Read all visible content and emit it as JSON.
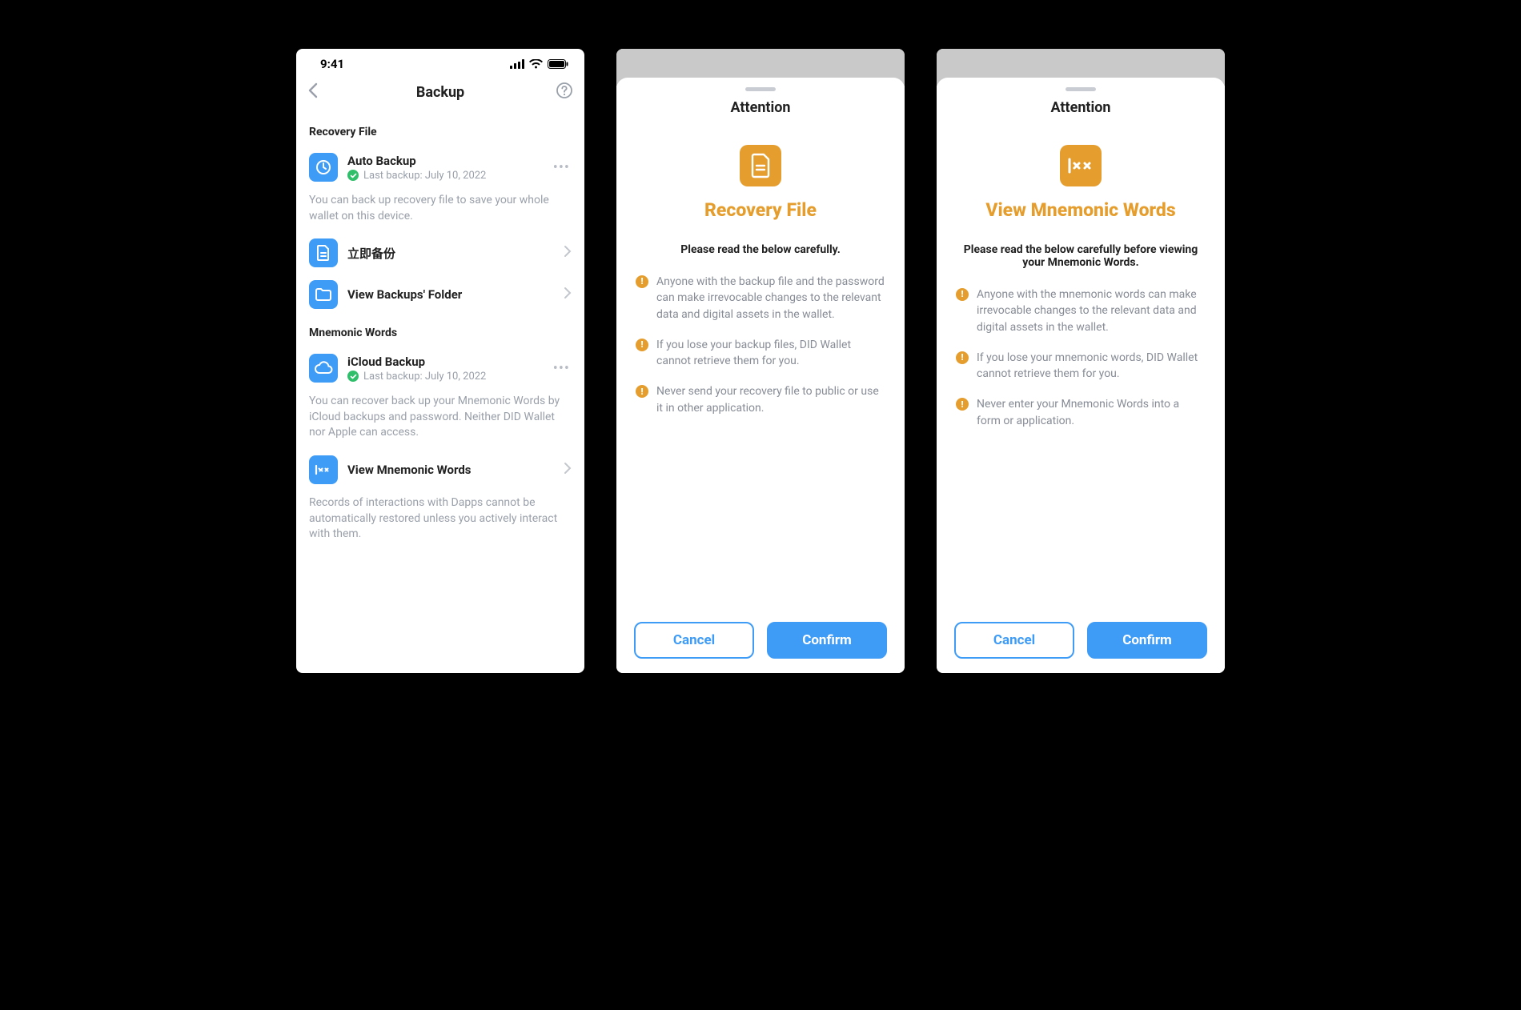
{
  "status": {
    "time": "9:41"
  },
  "screen_backup": {
    "title": "Backup",
    "section_recovery": "Recovery File",
    "auto_backup": {
      "title": "Auto Backup",
      "subtitle": "Last backup: July 10, 2022"
    },
    "recovery_desc": "You can back up recovery file to save your whole wallet on this device.",
    "backup_now": "立即备份",
    "view_backups": "View Backups' Folder",
    "section_mnemonic": "Mnemonic Words",
    "icloud_backup": {
      "title": "iCloud Backup",
      "subtitle": "Last backup: July 10, 2022"
    },
    "mnemonic_desc": "You can recover back up your Mnemonic Words by iCloud backups and password. Neither DID Wallet nor Apple can access.",
    "view_mnemonic": "View Mnemonic Words",
    "footnote": "Records of interactions with Dapps cannot be automatically restored unless you actively interact with them."
  },
  "modal_recovery": {
    "attention": "Attention",
    "heading": "Recovery File",
    "instruction": "Please read the below carefully.",
    "warnings": [
      "Anyone with the backup file and the password can make irrevocable changes to the relevant data and digital assets in the wallet.",
      "If you lose your backup files, DID Wallet cannot retrieve them for you.",
      "Never send your recovery file to public or use it in other application."
    ],
    "cancel": "Cancel",
    "confirm": "Confirm"
  },
  "modal_mnemonic": {
    "attention": "Attention",
    "heading": "View Mnemonic Words",
    "instruction": "Please read the below carefully before viewing your Mnemonic Words.",
    "warnings": [
      "Anyone with the mnemonic words can make irrevocable changes to the relevant data and digital assets in the wallet.",
      "If you lose your mnemonic words, DID Wallet cannot retrieve them for you.",
      "Never enter your Mnemonic Words into a form or application."
    ],
    "cancel": "Cancel",
    "confirm": "Confirm"
  }
}
